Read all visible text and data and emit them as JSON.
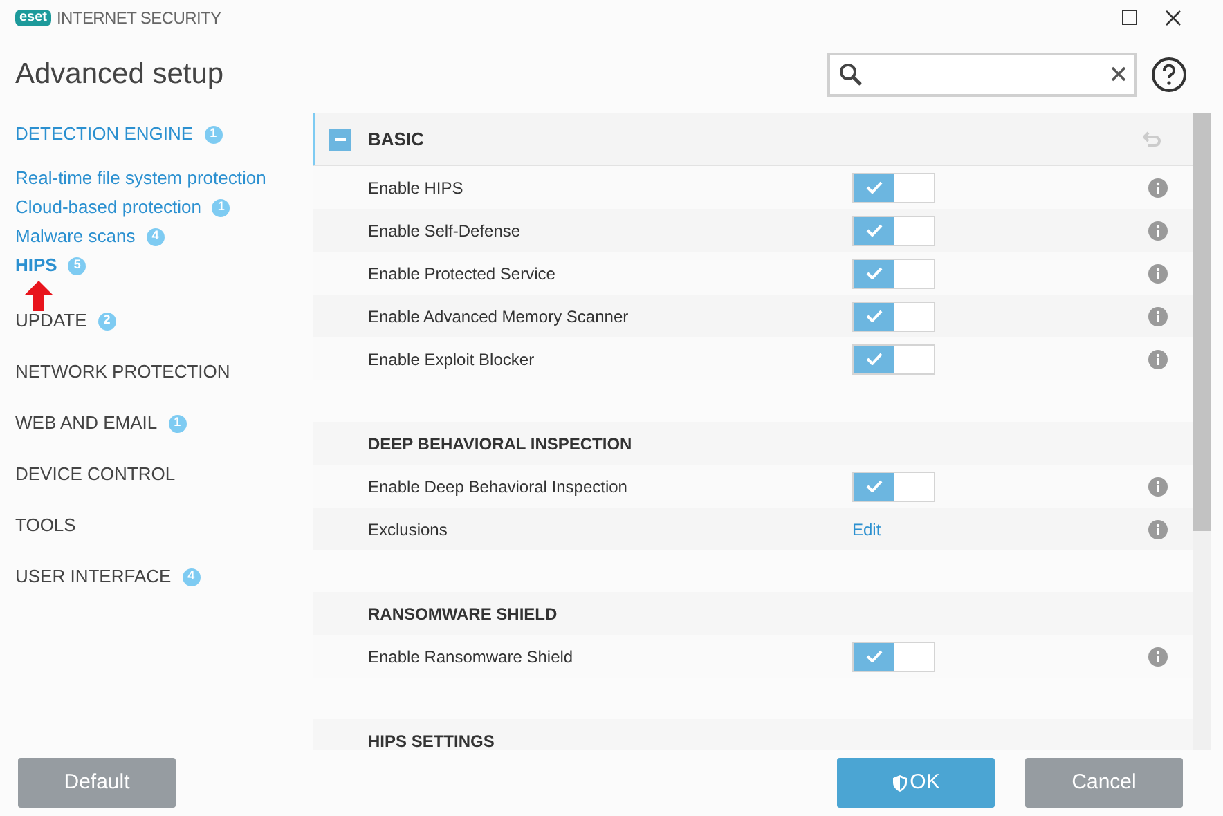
{
  "window": {
    "brand": "eset",
    "product": "INTERNET SECURITY"
  },
  "page_title": "Advanced setup",
  "sidebar": [
    {
      "kind": "section",
      "label": "DETECTION ENGINE",
      "badge": "1",
      "selected": false
    },
    {
      "kind": "sub",
      "label": "Real-time file system protection",
      "selected": false
    },
    {
      "kind": "sub",
      "label": "Cloud-based protection",
      "badge": "1",
      "selected": false
    },
    {
      "kind": "sub",
      "label": "Malware scans",
      "badge": "4",
      "selected": false
    },
    {
      "kind": "sub",
      "label": "HIPS",
      "badge": "5",
      "selected": true
    },
    {
      "kind": "section",
      "label": "UPDATE",
      "badge": "2",
      "selected": false
    },
    {
      "kind": "section",
      "label": "NETWORK PROTECTION",
      "selected": false
    },
    {
      "kind": "section",
      "label": "WEB AND EMAIL",
      "badge": "1",
      "selected": false
    },
    {
      "kind": "section",
      "label": "DEVICE CONTROL",
      "selected": false
    },
    {
      "kind": "section",
      "label": "TOOLS",
      "selected": false
    },
    {
      "kind": "section",
      "label": "USER INTERFACE",
      "badge": "4",
      "selected": false
    }
  ],
  "sections": [
    {
      "title": "BASIC",
      "expanded": true,
      "rows": [
        {
          "kind": "toggle",
          "label": "Enable HIPS",
          "on": true
        },
        {
          "kind": "toggle",
          "label": "Enable Self-Defense",
          "on": true
        },
        {
          "kind": "toggle",
          "label": "Enable Protected Service",
          "on": true
        },
        {
          "kind": "toggle",
          "label": "Enable Advanced Memory Scanner",
          "on": true
        },
        {
          "kind": "toggle",
          "label": "Enable Exploit Blocker",
          "on": true
        }
      ]
    },
    {
      "title": "DEEP BEHAVIORAL INSPECTION",
      "rows": [
        {
          "kind": "toggle",
          "label": "Enable Deep Behavioral Inspection",
          "on": true
        },
        {
          "kind": "link",
          "label": "Exclusions",
          "value": "Edit"
        }
      ]
    },
    {
      "title": "RANSOMWARE SHIELD",
      "rows": [
        {
          "kind": "toggle",
          "label": "Enable Ransomware Shield",
          "on": true
        }
      ]
    },
    {
      "title": "HIPS SETTINGS"
    }
  ],
  "buttons": {
    "default": "Default",
    "ok": "OK",
    "cancel": "Cancel"
  }
}
